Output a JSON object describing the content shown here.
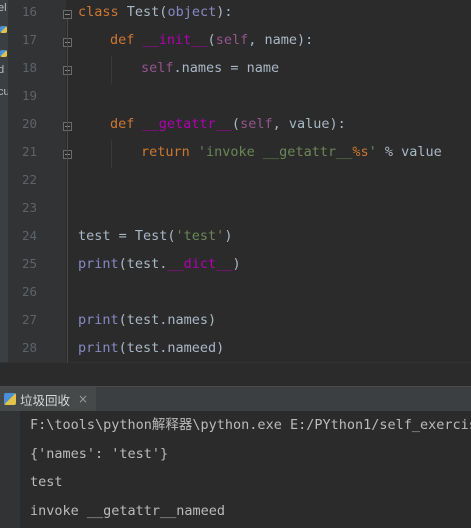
{
  "sidebar": {
    "labels": [
      "el",
      "d",
      "cu"
    ]
  },
  "editor": {
    "lines": [
      {
        "num": "16",
        "tokens": [
          [
            "kw",
            "class "
          ],
          [
            "cls",
            "Test"
          ],
          [
            "p",
            "("
          ],
          [
            "bi",
            "object"
          ],
          [
            "p",
            "):"
          ]
        ]
      },
      {
        "num": "17",
        "tokens": [
          [
            "kw",
            "def "
          ],
          [
            "mg",
            "__init__"
          ],
          [
            "p",
            "("
          ],
          [
            "sl",
            "self"
          ],
          [
            "p",
            ", name):"
          ]
        ]
      },
      {
        "num": "18",
        "tokens": [
          [
            "sl",
            "self"
          ],
          [
            "p",
            ".names = name"
          ]
        ]
      },
      {
        "num": "19",
        "tokens": []
      },
      {
        "num": "20",
        "tokens": [
          [
            "kw",
            "def "
          ],
          [
            "mg",
            "__getattr__"
          ],
          [
            "p",
            "("
          ],
          [
            "sl",
            "self"
          ],
          [
            "p",
            ", value):"
          ]
        ]
      },
      {
        "num": "21",
        "tokens": [
          [
            "kw",
            "return "
          ],
          [
            "st",
            "'invoke __getattr__"
          ],
          [
            "fmt",
            "%s"
          ],
          [
            "st",
            "'"
          ],
          [
            "p",
            " % value"
          ]
        ]
      },
      {
        "num": "22",
        "tokens": []
      },
      {
        "num": "23",
        "tokens": []
      },
      {
        "num": "24",
        "tokens": [
          [
            "p",
            "test = Test("
          ],
          [
            "st",
            "'test'"
          ],
          [
            "p",
            ")"
          ]
        ]
      },
      {
        "num": "25",
        "tokens": [
          [
            "bi",
            "print"
          ],
          [
            "p",
            "(test."
          ],
          [
            "mg",
            "__dict__"
          ],
          [
            "p",
            ")"
          ]
        ]
      },
      {
        "num": "26",
        "tokens": []
      },
      {
        "num": "27",
        "tokens": [
          [
            "bi",
            "print"
          ],
          [
            "p",
            "(test.names)"
          ]
        ]
      },
      {
        "num": "28",
        "tokens": [
          [
            "bi",
            "print"
          ],
          [
            "p",
            "(test.nameed)"
          ]
        ]
      }
    ]
  },
  "run_panel": {
    "tab_title": "垃圾回收",
    "close_label": "×",
    "output": [
      "F:\\tools\\python解释器\\python.exe E:/PYthon1/self_exercis",
      "{'names': 'test'}",
      "test",
      "invoke __getattr__nameed"
    ]
  },
  "colors": {
    "background": "#2b2b2b",
    "keyword": "#cc7832",
    "builtin": "#8888c6",
    "self": "#94558d",
    "magic": "#b200b2",
    "string": "#6a8759",
    "text": "#a9b7c6"
  }
}
